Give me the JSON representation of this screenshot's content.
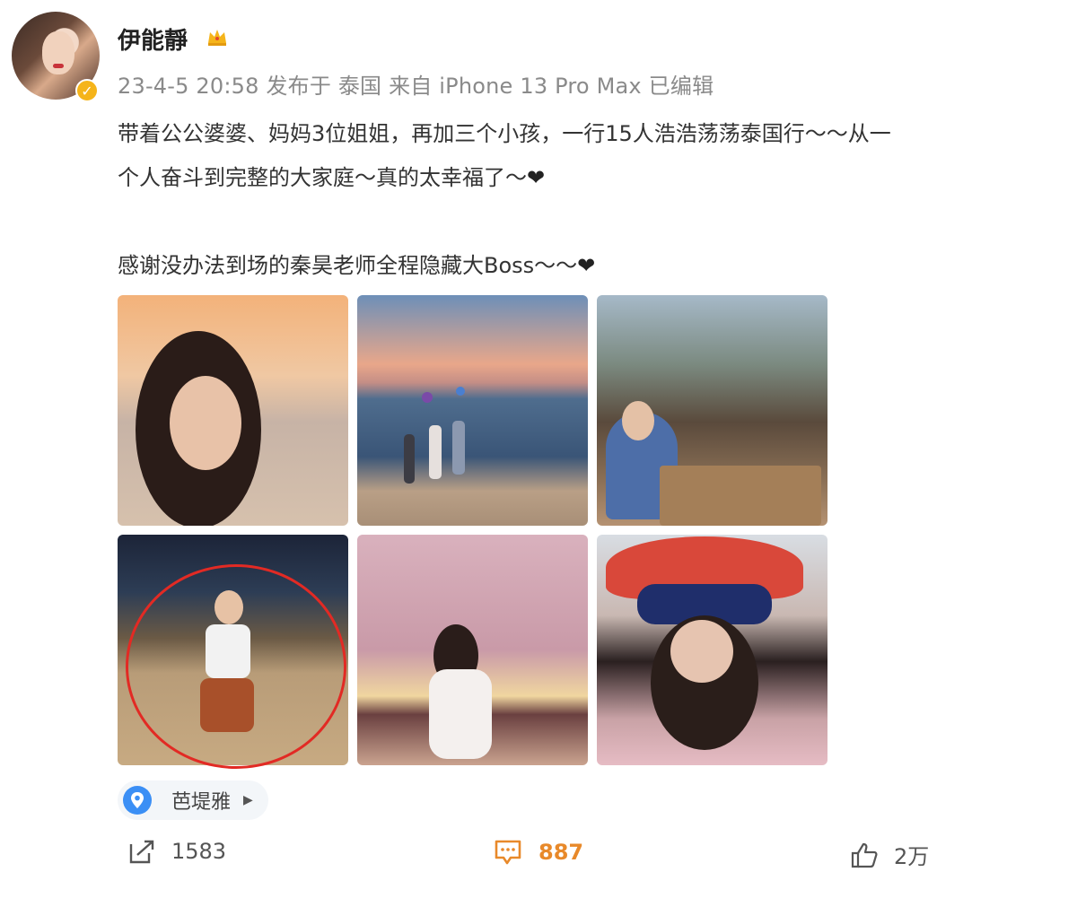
{
  "post": {
    "username": "伊能靜",
    "meta": "23-4-5 20:58 发布于 泰国 来自 iPhone 13 Pro Max 已编辑",
    "content_line1": "带着公公婆婆、妈妈3位姐姐，再加三个小孩，一行15人浩浩荡荡泰国行～～从一",
    "content_line2": "个人奋斗到完整的大家庭～真的太幸福了～",
    "content_line3": "感谢没办法到场的秦昊老师全程隐藏大Boss～～",
    "heart": "❤"
  },
  "photos": [
    {
      "name": "beach-selfie-photo"
    },
    {
      "name": "beach-kids-photo"
    },
    {
      "name": "family-dinner-photo"
    },
    {
      "name": "girl-on-beach-photo"
    },
    {
      "name": "woman-pink-room-photo"
    },
    {
      "name": "hat-selfie-photo"
    }
  ],
  "location": {
    "label": "芭堤雅",
    "icon": "location-pin-icon"
  },
  "actions": {
    "repost_count": "1583",
    "comment_count": "887",
    "like_count": "2万",
    "comment_color": "#e8892a"
  },
  "colors": {
    "verified": "#f5b41a",
    "annotation_circle": "#e22a24",
    "location_icon": "#3b8ff5"
  }
}
